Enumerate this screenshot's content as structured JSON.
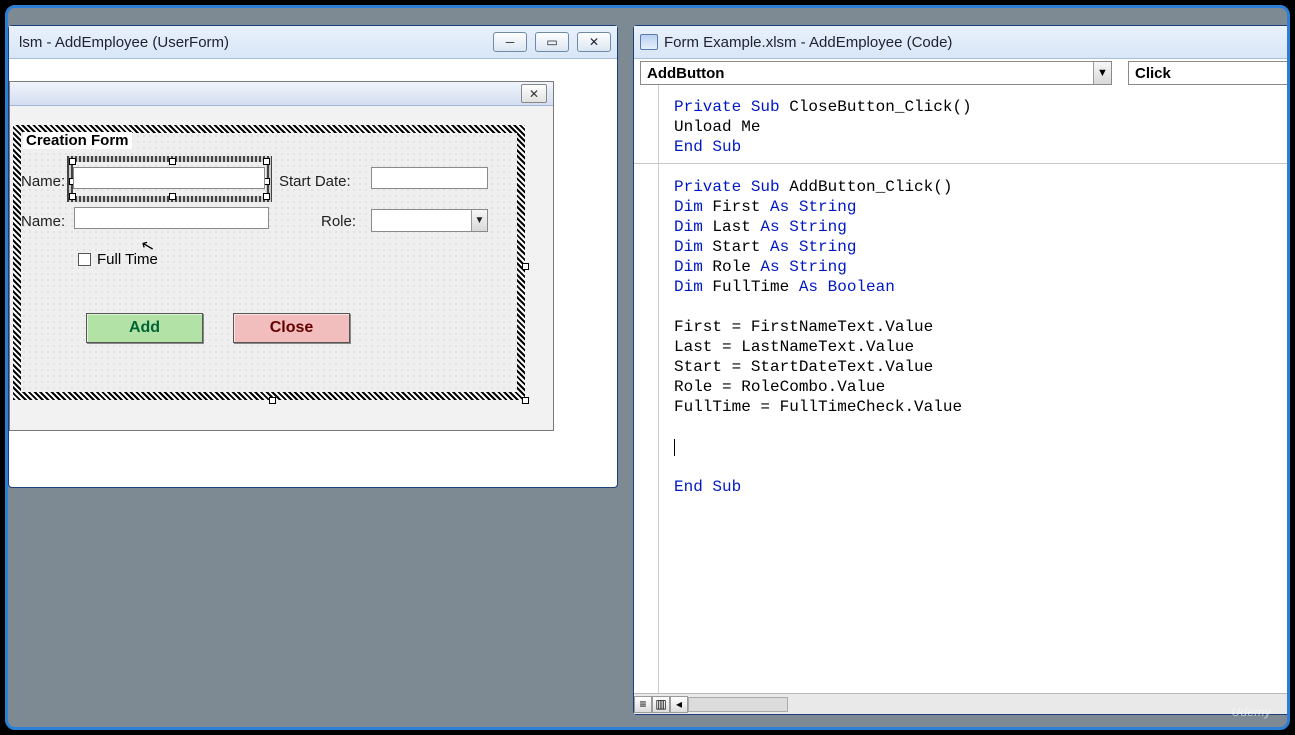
{
  "designer": {
    "title": "lsm - AddEmployee (UserForm)",
    "frame_label": "Creation Form",
    "labels": {
      "name1": "Name:",
      "name2": "Name:",
      "start_date": "Start Date:",
      "role": "Role:"
    },
    "checkbox": "Full Time",
    "buttons": {
      "add": "Add",
      "close": "Close"
    }
  },
  "code": {
    "title": "Form Example.xlsm - AddEmployee (Code)",
    "object_combo": "AddButton",
    "proc_combo": "Click",
    "lines": [
      {
        "t": "Private Sub",
        "r": " CloseButton_Click()",
        "kind": "sig"
      },
      {
        "t": "",
        "r": "Unload Me"
      },
      {
        "t": "End Sub",
        "r": ""
      },
      {
        "t": "",
        "r": "",
        "blank": true
      },
      {
        "t": "Private Sub",
        "r": " AddButton_Click()",
        "kind": "sig"
      },
      {
        "t": "Dim",
        "r": " First ",
        "t2": "As String"
      },
      {
        "t": "Dim",
        "r": " Last ",
        "t2": "As String"
      },
      {
        "t": "Dim",
        "r": " Start ",
        "t2": "As String"
      },
      {
        "t": "Dim",
        "r": " Role ",
        "t2": "As String"
      },
      {
        "t": "Dim",
        "r": " FullTime ",
        "t2": "As Boolean"
      },
      {
        "t": "",
        "r": "",
        "blank": true
      },
      {
        "t": "",
        "r": "First = FirstNameText.Value"
      },
      {
        "t": "",
        "r": "Last = LastNameText.Value"
      },
      {
        "t": "",
        "r": "Start = StartDateText.Value"
      },
      {
        "t": "",
        "r": "Role = RoleCombo.Value"
      },
      {
        "t": "",
        "r": "FullTime = FullTimeCheck.Value"
      },
      {
        "t": "",
        "r": "",
        "blank": true
      },
      {
        "t": "",
        "r": "",
        "caret": true
      },
      {
        "t": "",
        "r": "",
        "blank": true
      },
      {
        "t": "End Sub",
        "r": ""
      }
    ]
  },
  "watermark": "Udemy"
}
